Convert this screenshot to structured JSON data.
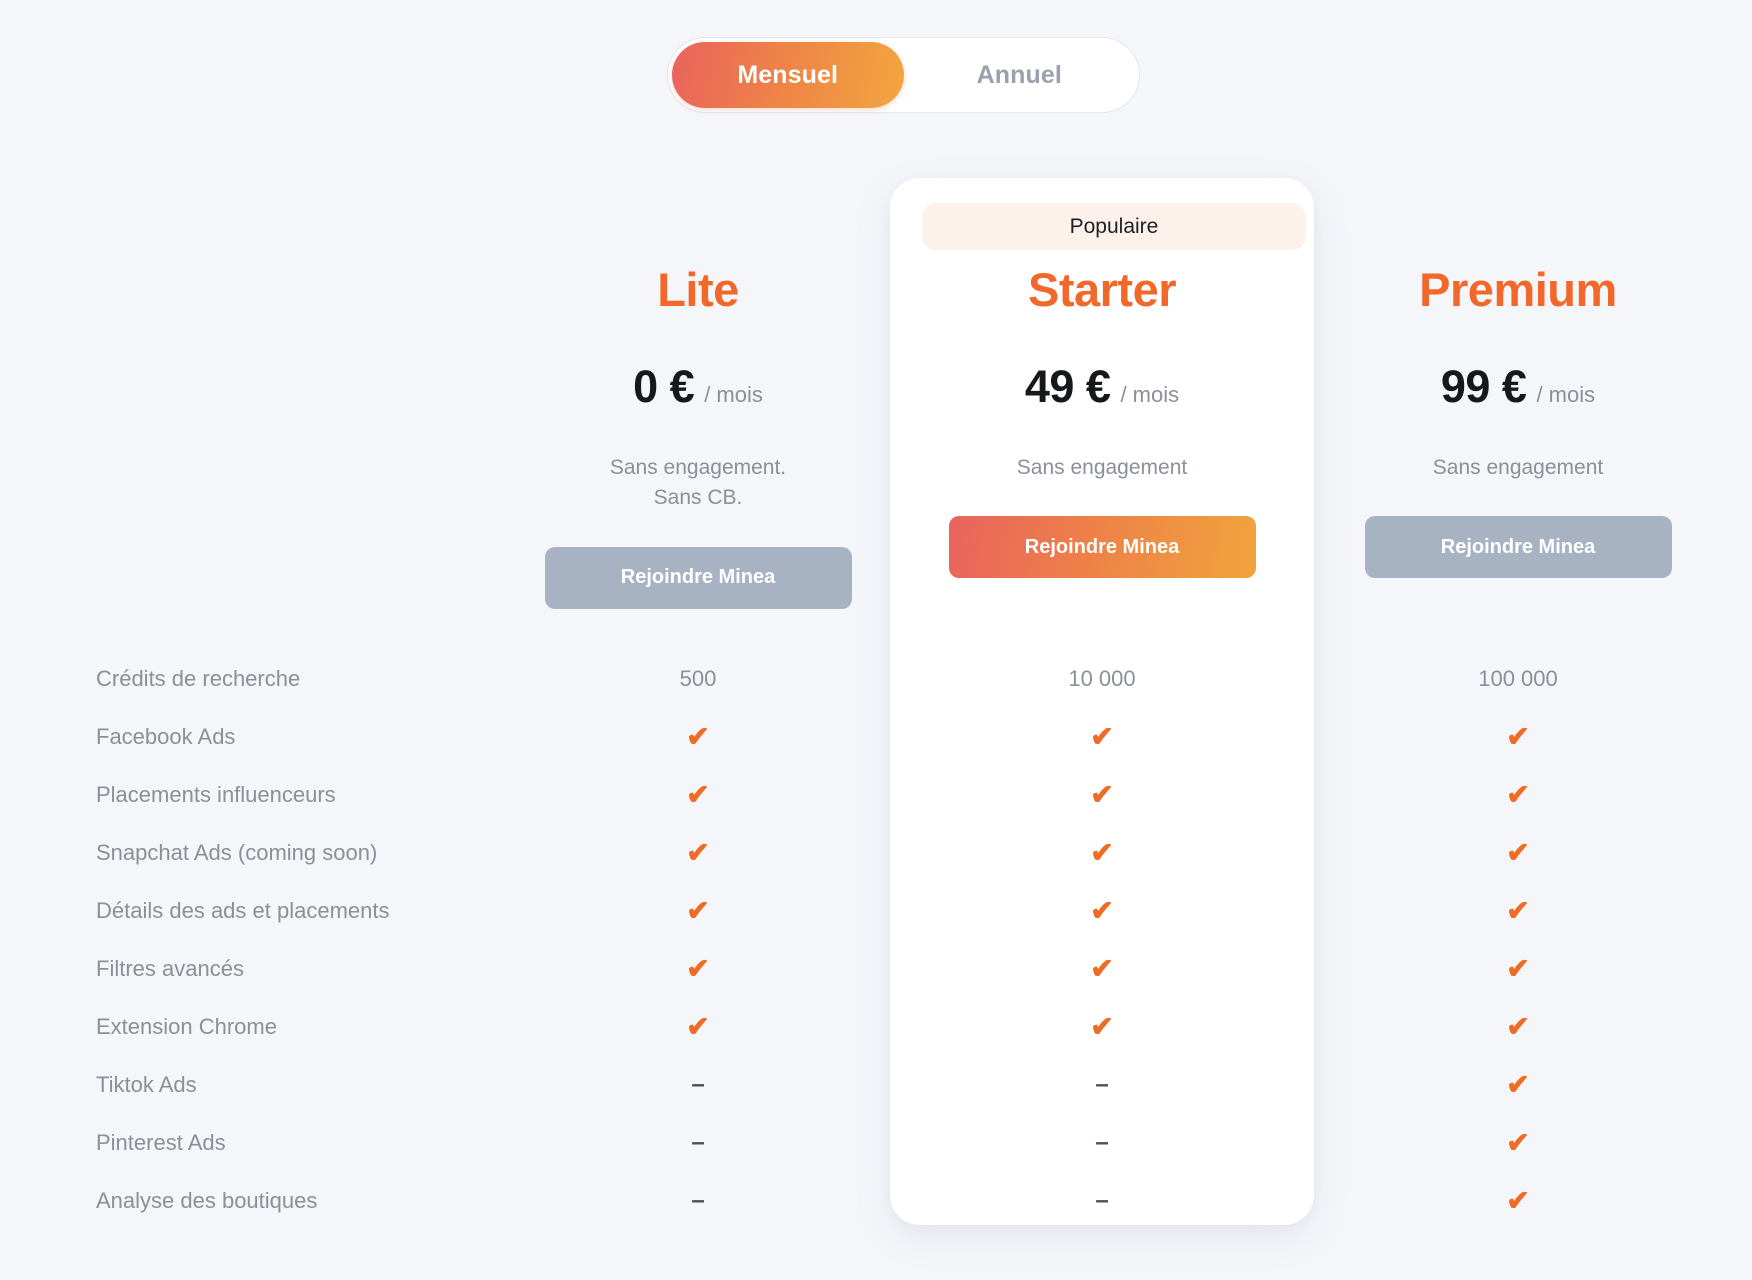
{
  "billing_toggle": {
    "options": [
      {
        "label": "Mensuel",
        "active": true
      },
      {
        "label": "Annuel",
        "active": false
      }
    ]
  },
  "popular_badge": {
    "label": "Populaire"
  },
  "plans": [
    {
      "name": "Lite",
      "price": "0 €",
      "period": "/ mois",
      "note_line1": "Sans engagement.",
      "note_line2": "Sans CB.",
      "cta_label": "Rejoindre Minea",
      "cta_style": "muted",
      "popular": false
    },
    {
      "name": "Starter",
      "price": "49 €",
      "period": "/ mois",
      "note_line1": "Sans engagement",
      "note_line2": "",
      "cta_label": "Rejoindre Minea",
      "cta_style": "accent",
      "popular": true
    },
    {
      "name": "Premium",
      "price": "99 €",
      "period": "/ mois",
      "note_line1": "Sans engagement",
      "note_line2": "",
      "cta_label": "Rejoindre Minea",
      "cta_style": "muted",
      "popular": false
    }
  ],
  "features": [
    {
      "label": "Crédits de recherche",
      "lite": "500",
      "starter": "10 000",
      "premium": "100 000"
    },
    {
      "label": "Facebook Ads",
      "lite": "check",
      "starter": "check",
      "premium": "check"
    },
    {
      "label": "Placements influenceurs",
      "lite": "check",
      "starter": "check",
      "premium": "check"
    },
    {
      "label": "Snapchat Ads (coming soon)",
      "lite": "check",
      "starter": "check",
      "premium": "check"
    },
    {
      "label": "Détails des ads et placements",
      "lite": "check",
      "starter": "check",
      "premium": "check"
    },
    {
      "label": "Filtres avancés",
      "lite": "check",
      "starter": "check",
      "premium": "check"
    },
    {
      "label": "Extension Chrome",
      "lite": "check",
      "starter": "check",
      "premium": "check"
    },
    {
      "label": "Tiktok Ads",
      "lite": "dash",
      "starter": "dash",
      "premium": "check"
    },
    {
      "label": "Pinterest Ads",
      "lite": "dash",
      "starter": "dash",
      "premium": "check"
    },
    {
      "label": "Analyse des boutiques",
      "lite": "dash",
      "starter": "dash",
      "premium": "check"
    }
  ],
  "glyphs": {
    "check": "✔",
    "dash": "–"
  },
  "colors": {
    "accent_orange": "#F2682A",
    "check_orange": "#EE6C24",
    "gradient_start": "#E8635E",
    "gradient_end": "#F0A43D",
    "muted_button": "#A7B3C3",
    "page_background": "#F5F6FA",
    "badge_background": "#FDF1EB",
    "label_gray": "#8B8F98",
    "price_dark": "#17181C"
  }
}
